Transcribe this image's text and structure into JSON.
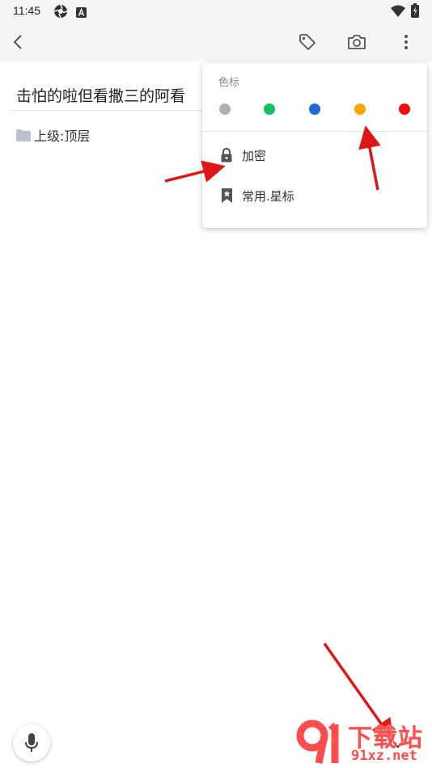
{
  "status": {
    "time": "11:45"
  },
  "note": {
    "title": "击怕的啦但看撒三的阿看",
    "parent_label": "上级:顶层"
  },
  "popup": {
    "color_heading": "色标",
    "colors": [
      "#b0b0b0",
      "#0dc25f",
      "#1f6bd1",
      "#ffa400",
      "#f50d0d"
    ],
    "items": [
      {
        "label": "加密",
        "icon": "lock-icon"
      },
      {
        "label": "常用.星标",
        "icon": "bookmark-star-icon"
      }
    ]
  },
  "watermark": {
    "main": "下载站",
    "sub": "91xz.net"
  }
}
